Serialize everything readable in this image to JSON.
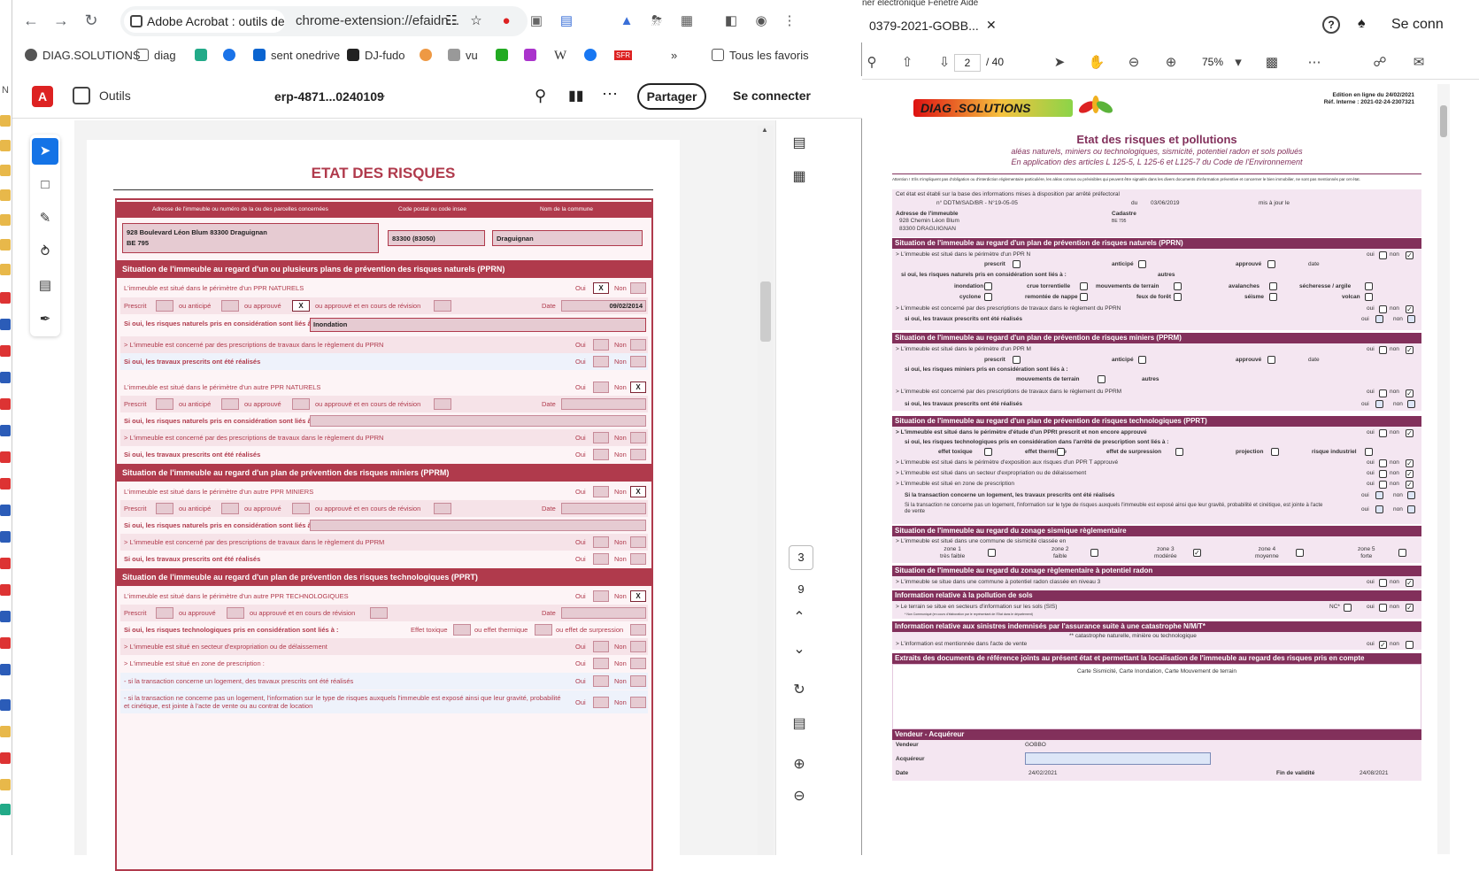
{
  "left_strip": {
    "label": "N"
  },
  "browser": {
    "tab_title": "Adobe Acrobat : outils de m",
    "url": "chrome-extension://efaidn...",
    "bookmarks": [
      "DIAG.SOLUTIONS",
      "diag",
      "",
      "",
      "sent onedrive",
      "DJ-fudo",
      "",
      "vu",
      "",
      "",
      "W",
      "",
      "SFR",
      "»",
      "Tous les favoris"
    ]
  },
  "acrobat": {
    "outils": "Outils",
    "filename": "erp-4871...0240109",
    "share": "Partager",
    "signin": "Se connecter",
    "page_current": "3",
    "page_total": "9"
  },
  "form": {
    "title": "ETAT DES RISQUES",
    "col_headers": [
      "Adresse de l'immeuble ou numéro de la ou des parcelles concernées",
      "Code postal ou code insee",
      "Nom de la commune"
    ],
    "address_line1": "928 Boulevard Léon Blum 83300 Draguignan",
    "address_line2": "BE 795",
    "postal": "83300 (83050)",
    "commune": "Draguignan",
    "sec_pprn": "Situation de l'immeuble au regard d'un ou plusieurs plans de prévention des risques naturels (PPRN)",
    "sec_pprm": "Situation de l'immeuble au regard d'un plan de prévention des risques miniers (PPRM)",
    "sec_pprt": "Situation de l'immeuble au regard d'un plan de prévention des risques technologiques (PPRT)",
    "r1": "L'immeuble est situé dans le périmètre d'un PPR NATURELS",
    "oui": "Oui",
    "non": "Non",
    "x": "X",
    "prescrit": "Prescrit",
    "anticipe": "ou anticipé",
    "approuve": "ou approuvé",
    "revision": "ou approuvé et en cours de révision",
    "date": "Date",
    "date_val": "09/02/2014",
    "si_oui_nat": "Si oui, les risques naturels pris en considération sont liés à :",
    "inondation": "Inondation",
    "travaux_pprn": "> L'immeuble est concerné par des prescriptions de travaux dans le règlement du PPRN",
    "travaux_real": "Si oui, les travaux prescrits ont été réalisés",
    "r_autre_nat": "L'immeuble est situé dans le périmètre d'un autre PPR NATURELS",
    "r_autre_min": "L'immeuble est situé dans le périmètre d'un autre PPR MINIERS",
    "si_oui_min": "Si oui, les risques naturels pris en considération sont liés à :",
    "travaux_pprm": "> L'immeuble est concerné par des prescriptions de travaux dans le règlement du PPRM",
    "r_autre_tech": "L'immeuble est situé dans le périmètre d'un autre PPR TECHNOLOGIQUES",
    "si_oui_tech": "Si oui, les risques technologiques pris en considération sont liés à :",
    "effet_toxique": "Effet toxique",
    "effet_thermique": "ou effet thermique",
    "effet_surpression": "ou effet de surpression",
    "expropriation": "> L'immeuble est situé en secteur d'expropriation ou de délaissement",
    "zone_prescription": "> L'immeuble est situé en zone de prescription :",
    "logement": "- si la transaction concerne un logement, des travaux prescrits ont été réalisés",
    "non_logement": "- si la transaction ne concerne pas un logement, l'information sur le type de risques auxquels l'immeuble est exposé ainsi que leur gravité, probabilité et cinétique, est jointe à l'acte de vente ou au contrat de location"
  },
  "pdf": {
    "menu": "ner électronique     Fenêtre     Aide",
    "tab_title": "0379-2021-GOBB...",
    "signin": "Se conn",
    "page_input": "2",
    "page_total": "/ 40",
    "zoom": "75%",
    "logo": "DIAG .SOLUTIONS",
    "edition": "Edition en ligne du 24/02/2021",
    "ref": "Réf. Interne : 2021-02-24-2307321",
    "title": "Etat des risques et pollutions",
    "subtitle1": "aléas naturels, miniers ou technologiques, sismicité, potentiel radon et sols pollués",
    "subtitle2": "En application des articles L 125-5, L 125-6 et L125-7 du Code de l'Environnement",
    "attention": "Attention ! S'ils n'impliquent pas d'obligation ou d'interdiction réglementaire particulière, les aléas connus ou prévisibles qui peuvent être signalés dans les divers documents d'information préventive et concerner le bien immobilier, ne sont pas mentionnés par cet état.",
    "etat_base": "Cet état est établi sur la base des informations mises à disposition par arrêté préfectoral",
    "arrete_no": "n°  DDTM/SAD/BR - N°19-05-05",
    "du": "du",
    "arrete_date": "03/06/2019",
    "maj": "mis à jour le",
    "adresse_lbl": "Adresse de l'immeuble",
    "adresse1": "928 Chemin Léon Blum",
    "adresse2": "83300 DRAGUIGNAN",
    "cadastre_lbl": "Cadastre",
    "cadastre": "BE 795",
    "sections": [
      "Situation de l'immeuble au regard d'un plan de prévention de risques naturels (PPRN)",
      "Situation de l'immeuble au regard d'un plan de prévention de risques miniers (PPRM)",
      "Situation de l'immeuble au regard d'un plan de prévention de risques technologiques (PPRT)",
      "Situation de l'immeuble au regard du zonage sismique règlementaire",
      "Situation de l'immeuble au regard du zonage règlementaire à potentiel radon",
      "Information relative à la pollution de sols",
      "Information relative aux sinistres indemnisés par l'assurance suite à une catastrophe N/M/T*",
      "Extraits des documents de référence joints au présent état et permettant la localisation de l'immeuble au regard des risques pris en compte",
      "Vendeur - Acquéreur"
    ],
    "pprn_line": ">   L'immeuble est situé dans le périmètre d'un PPR N",
    "pprm_line": ">   L'immeuble est situé dans le périmètre d'un PPR M",
    "pprt_line": ">   L'immeuble est situé dans le périmètre d'étude d'un PPRt prescrit et non encore approuvé",
    "oui": "oui",
    "non": "non",
    "prescrit": "prescrit",
    "anticipe": "anticipé",
    "approuve": "approuvé",
    "date": "date",
    "si_oui_nat": "si oui, les risques naturels pris en considération sont liés à :",
    "autres": "autres",
    "risques_nat": [
      "inondation",
      "crue torrentielle",
      "mouvements de terrain",
      "avalanches",
      "sécheresse / argile",
      "cyclone",
      "remontée de nappe",
      "feux de forêt",
      "séisme",
      "volcan"
    ],
    "pprn_travaux": ">   L'immeuble est concerné par des prescriptions de travaux dans le règlement du PPRN",
    "travaux_real": "si oui, les travaux prescrits ont été réalisés",
    "si_oui_min": "si oui, les risques miniers pris en considération sont liés à :",
    "mvt_terrain": "mouvements de terrain",
    "pprm_travaux": ">   L'immeuble est concerné par des prescriptions de travaux dans le règlement du PPRM",
    "si_oui_tech": "si oui, les risques technologiques pris en considération dans l'arrêté de prescription sont liés à :",
    "risques_tech": [
      "effet toxique",
      "effet thermique",
      "effet de surpression",
      "projection",
      "risque industriel"
    ],
    "pprt_expo": ">   L'immeuble est situé dans le périmètre d'exposition aux risques d'un PPR T approuvé",
    "pprt_expro": ">   L'immeuble est situé dans un secteur d'expropriation ou de délaissement",
    "pprt_zone": ">   L'immeuble est situé en zone de prescription",
    "pprt_log": "Si la transaction concerne un logement, les travaux prescrits ont été réalisés",
    "pprt_nonlog": "Si la transaction ne concerne pas un logement, l'information sur le type de risques auxquels l'immeuble est exposé ainsi que leur gravité, probabilité et cinétique, est jointe à l'acte de vente",
    "sismique_line": ">   L'immeuble est situé dans une commune de sismicité classée en",
    "zones": [
      "zone 1",
      "zone 2",
      "zone 3",
      "zone 4",
      "zone 5"
    ],
    "zone_labels": [
      "très faible",
      "faible",
      "modérée",
      "moyenne",
      "forte"
    ],
    "radon_line": ">   L'immeuble se situe dans une commune à potentiel radon classée en niveau 3",
    "sis_line": ">   Le terrain se situe en secteurs d'information sur les sols (SIS)",
    "nc": "NC*",
    "sis_note": "* Non Communiqué (en cours d'élaboration par le représentant de l'Etat dans le département)",
    "catnat_note": "** catastrophe naturelle, minière ou technologique",
    "catnat_line": ">   L'information est mentionnée dans l'acte de vente",
    "extraits": "Carte Sismicité, Carte Inondation, Carte Mouvement de terrain",
    "vendeur_lbl": "Vendeur",
    "vendeur": "GOBBO",
    "acquereur_lbl": "Acquéreur",
    "date_lbl": "Date",
    "date_val": "24/02/2021",
    "fin_lbl": "Fin de validité",
    "fin_val": "24/08/2021"
  }
}
